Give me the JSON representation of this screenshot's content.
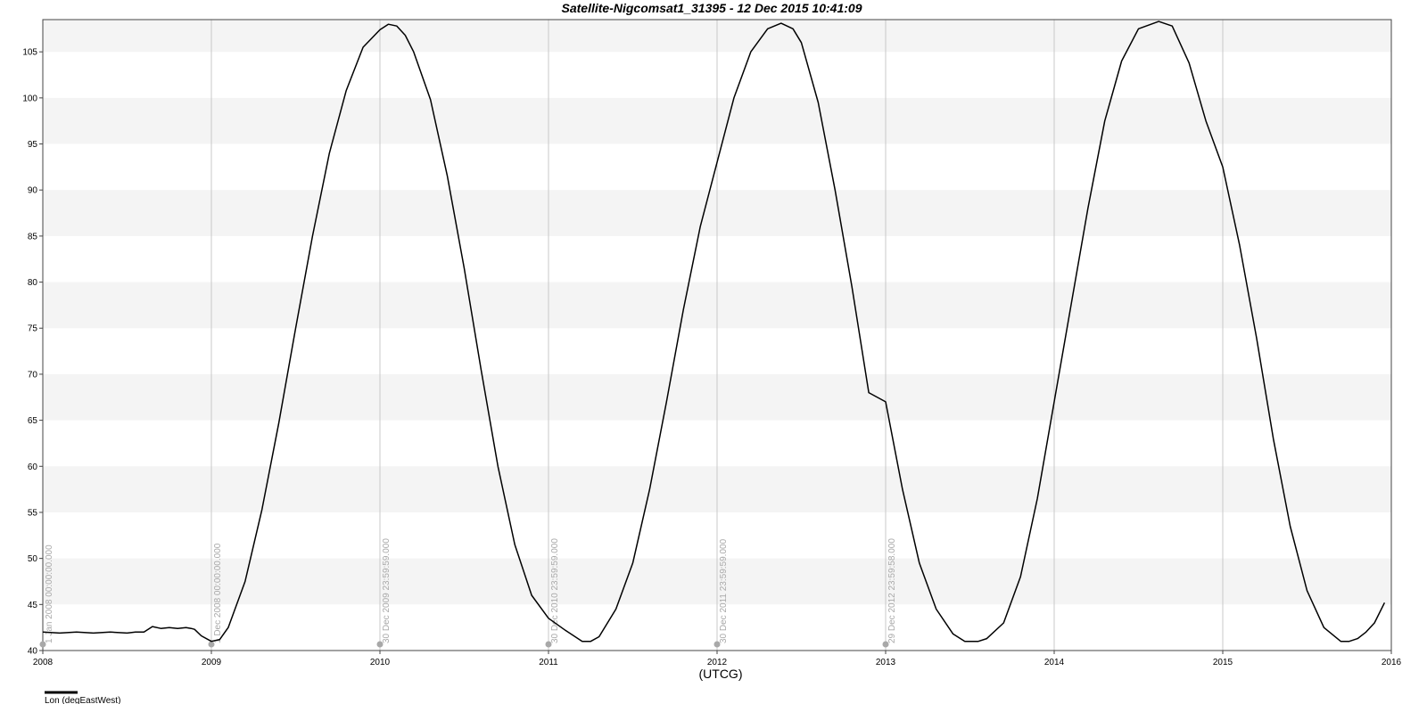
{
  "chart_data": {
    "type": "line",
    "title": "Satellite-Nigcomsat1_31395 - 12 Dec 2015 10:41:09",
    "xlabel": "(UTCG)",
    "ylabel": "",
    "xlim": [
      2008.0,
      2016.0
    ],
    "ylim": [
      40,
      108.5
    ],
    "x_ticks": [
      2008,
      2009,
      2010,
      2011,
      2012,
      2013,
      2014,
      2015,
      2016
    ],
    "x_tick_labels": [
      "2008",
      "2009",
      "2010",
      "2011",
      "2012",
      "2013",
      "2014",
      "2015",
      "2016"
    ],
    "y_ticks": [
      40,
      45,
      50,
      55,
      60,
      65,
      70,
      75,
      80,
      85,
      90,
      95,
      100,
      105
    ],
    "y_tick_labels": [
      "40",
      "45",
      "50",
      "55",
      "60",
      "65",
      "70",
      "75",
      "80",
      "85",
      "90",
      "95",
      "100",
      "105"
    ],
    "grid": true,
    "alternating_bands": true,
    "legend": [
      {
        "label": "Lon (degEastWest)",
        "color": "#000000",
        "position": "bottom-left"
      }
    ],
    "annotations": [
      {
        "x": 2008.0,
        "label": "1 Jan 2008 00:00:00.000"
      },
      {
        "x": 2009.0,
        "label": "1 Dec 2008 00:00:00.000"
      },
      {
        "x": 2010.0,
        "label": "30 Dec 2009 23:59:59.000"
      },
      {
        "x": 2011.0,
        "label": "30 Dec 2010 23:59:59.000"
      },
      {
        "x": 2012.0,
        "label": "30 Dec 2011 23:59:59.000"
      },
      {
        "x": 2013.0,
        "label": "29 Dec 2012 23:59:58.000"
      }
    ],
    "series": [
      {
        "name": "Lon (degEastWest)",
        "color": "#000000",
        "x": [
          2008.0,
          2008.1,
          2008.2,
          2008.3,
          2008.4,
          2008.5,
          2008.55,
          2008.6,
          2008.65,
          2008.7,
          2008.75,
          2008.8,
          2008.85,
          2008.88,
          2008.9,
          2008.94,
          2009.0,
          2009.05,
          2009.1,
          2009.2,
          2009.3,
          2009.4,
          2009.5,
          2009.6,
          2009.7,
          2009.8,
          2009.9,
          2010.0,
          2010.05,
          2010.1,
          2010.15,
          2010.2,
          2010.3,
          2010.4,
          2010.5,
          2010.6,
          2010.7,
          2010.8,
          2010.9,
          2011.0,
          2011.1,
          2011.2,
          2011.25,
          2011.3,
          2011.4,
          2011.5,
          2011.6,
          2011.7,
          2011.8,
          2011.9,
          2012.0,
          2012.1,
          2012.2,
          2012.3,
          2012.38,
          2012.45,
          2012.5,
          2012.6,
          2012.7,
          2012.8,
          2012.9,
          2013.0,
          2013.1,
          2013.2,
          2013.3,
          2013.4,
          2013.47,
          2013.55,
          2013.6,
          2013.7,
          2013.8,
          2013.9,
          2014.0,
          2014.1,
          2014.2,
          2014.3,
          2014.4,
          2014.5,
          2014.62,
          2014.7,
          2014.8,
          2014.9,
          2015.0,
          2015.1,
          2015.2,
          2015.3,
          2015.4,
          2015.5,
          2015.6,
          2015.7,
          2015.75,
          2015.8,
          2015.85,
          2015.9,
          2015.96
        ],
        "y": [
          42.0,
          41.9,
          42.0,
          41.9,
          42.0,
          41.9,
          42.0,
          42.0,
          42.6,
          42.4,
          42.5,
          42.4,
          42.5,
          42.4,
          42.3,
          41.6,
          41.0,
          41.2,
          42.5,
          47.5,
          55.3,
          64.7,
          75.0,
          85.0,
          94.0,
          100.8,
          105.5,
          107.4,
          108.0,
          107.8,
          106.8,
          105.0,
          99.8,
          91.5,
          81.5,
          70.5,
          60.0,
          51.5,
          46.0,
          43.5,
          42.2,
          41.0,
          41.0,
          41.5,
          44.5,
          49.5,
          57.5,
          67.0,
          77.0,
          86.0,
          93.0,
          100.0,
          105.0,
          107.5,
          108.1,
          107.5,
          106.0,
          99.5,
          90.0,
          79.5,
          68.0,
          67.0,
          57.5,
          49.5,
          44.5,
          41.8,
          41.0,
          41.0,
          41.3,
          43.0,
          48.0,
          56.5,
          67.0,
          77.5,
          88.0,
          97.5,
          104.0,
          107.5,
          108.3,
          107.8,
          103.8,
          97.5,
          92.5,
          84.0,
          74.0,
          63.0,
          53.5,
          46.5,
          42.5,
          41.0,
          41.0,
          41.3,
          42.0,
          43.0,
          45.2
        ]
      }
    ]
  }
}
